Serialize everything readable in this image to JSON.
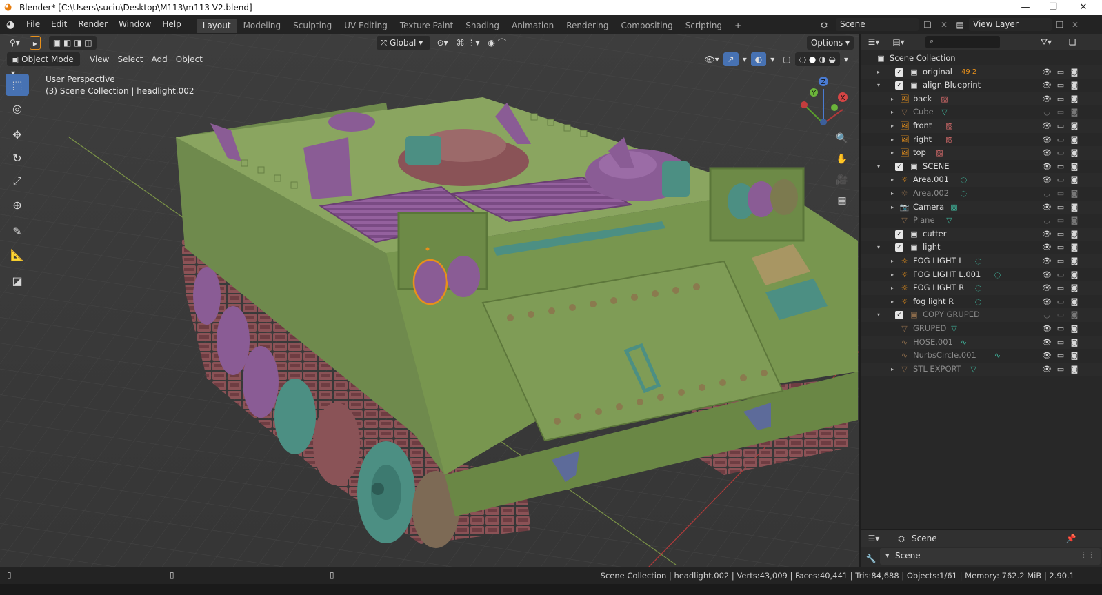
{
  "window": {
    "title": "Blender* [C:\\Users\\suciu\\Desktop\\M113\\m113 V2.blend]",
    "controls": [
      "—",
      "❐",
      "✕"
    ]
  },
  "menu": [
    "File",
    "Edit",
    "Render",
    "Window",
    "Help"
  ],
  "workspaces": [
    {
      "label": "Layout",
      "active": true
    },
    {
      "label": "Modeling"
    },
    {
      "label": "Sculpting"
    },
    {
      "label": "UV Editing"
    },
    {
      "label": "Texture Paint"
    },
    {
      "label": "Shading"
    },
    {
      "label": "Animation"
    },
    {
      "label": "Rendering"
    },
    {
      "label": "Compositing"
    },
    {
      "label": "Scripting"
    }
  ],
  "add_workspace": "+",
  "scene_field": "Scene",
  "view_layer_field": "View Layer",
  "viewport": {
    "transform_orientation": "Global",
    "options_label": "Options",
    "mode": "Object Mode",
    "header_menus": [
      "View",
      "Select",
      "Add",
      "Object"
    ],
    "overlay_line1": "User Perspective",
    "overlay_line2": "(3) Scene Collection | headlight.002",
    "gizmo_axes": {
      "x": "X",
      "y": "Y",
      "z": "Z"
    },
    "tools": [
      {
        "name": "select-box-tool",
        "icon": "⬚",
        "active": true
      },
      {
        "name": "cursor-tool",
        "icon": "◎"
      },
      {
        "name": "move-tool",
        "icon": "✥"
      },
      {
        "name": "rotate-tool",
        "icon": "↻"
      },
      {
        "name": "scale-tool",
        "icon": "⤢"
      },
      {
        "name": "transform-tool",
        "icon": "⊕"
      },
      {
        "name": "annotate-tool",
        "icon": "✎"
      },
      {
        "name": "measure-tool",
        "icon": "📐"
      },
      {
        "name": "add-cube-tool",
        "icon": "◪"
      }
    ],
    "nav_buttons": [
      {
        "name": "zoom-icon",
        "icon": "🔍"
      },
      {
        "name": "pan-hand-icon",
        "icon": "✋"
      },
      {
        "name": "camera-view-icon",
        "icon": "🎥"
      },
      {
        "name": "grid-ortho-icon",
        "icon": "▦"
      }
    ]
  },
  "outliner": {
    "root": "Scene Collection",
    "rows": [
      {
        "label": "original",
        "depth": 0,
        "expand": "▸",
        "kind": "collection",
        "check": true,
        "extra": "49 2",
        "dim": false,
        "vis_on": true
      },
      {
        "label": "align Blueprint",
        "depth": 0,
        "expand": "▾",
        "kind": "collection",
        "check": true,
        "dim": false,
        "vis_on": true
      },
      {
        "label": "back",
        "depth": 1,
        "expand": "▸",
        "kind": "image",
        "dim": false,
        "vis_on": true
      },
      {
        "label": "Cube",
        "depth": 1,
        "expand": "▸",
        "kind": "mesh",
        "dim": true,
        "vis_on": false
      },
      {
        "label": "front",
        "depth": 1,
        "expand": "▸",
        "kind": "image",
        "dim": false,
        "vis_on": true
      },
      {
        "label": "right",
        "depth": 1,
        "expand": "▸",
        "kind": "image",
        "dim": false,
        "vis_on": true
      },
      {
        "label": "top",
        "depth": 1,
        "expand": "▸",
        "kind": "image",
        "dim": false,
        "vis_on": true
      },
      {
        "label": "SCENE",
        "depth": 0,
        "expand": "▾",
        "kind": "collection",
        "check": true,
        "dim": false,
        "vis_on": true
      },
      {
        "label": "Area.001",
        "depth": 1,
        "expand": "▸",
        "kind": "light",
        "dim": false,
        "vis_on": true
      },
      {
        "label": "Area.002",
        "depth": 1,
        "expand": "▸",
        "kind": "light",
        "dim": true,
        "vis_on": false
      },
      {
        "label": "Camera",
        "depth": 1,
        "expand": "▸",
        "kind": "camera",
        "dim": false,
        "vis_on": true
      },
      {
        "label": "Plane",
        "depth": 1,
        "expand": "",
        "kind": "mesh",
        "dim": true,
        "vis_on": false
      },
      {
        "label": "cutter",
        "depth": 0,
        "expand": "",
        "kind": "collection",
        "check": true,
        "dim": false,
        "vis_on": true
      },
      {
        "label": "light",
        "depth": 0,
        "expand": "▾",
        "kind": "collection",
        "check": true,
        "dim": false,
        "vis_on": true
      },
      {
        "label": "FOG LIGHT L",
        "depth": 1,
        "expand": "▸",
        "kind": "light",
        "dim": false,
        "vis_on": true
      },
      {
        "label": "FOG LIGHT L.001",
        "depth": 1,
        "expand": "▸",
        "kind": "light",
        "dim": false,
        "vis_on": true
      },
      {
        "label": "FOG LIGHT R",
        "depth": 1,
        "expand": "▸",
        "kind": "light",
        "dim": false,
        "vis_on": true
      },
      {
        "label": "fog light R",
        "depth": 1,
        "expand": "▸",
        "kind": "light",
        "dim": false,
        "vis_on": true
      },
      {
        "label": "COPY GRUPED",
        "depth": 0,
        "expand": "▾",
        "kind": "collection",
        "check": true,
        "dim": true,
        "vis_on": false
      },
      {
        "label": "GRUPED",
        "depth": 1,
        "expand": "",
        "kind": "mesh",
        "dim": true,
        "vis_on": true
      },
      {
        "label": "HOSE.001",
        "depth": 1,
        "expand": "",
        "kind": "curve",
        "dim": true,
        "vis_on": true
      },
      {
        "label": "NurbsCircle.001",
        "depth": 1,
        "expand": "",
        "kind": "curve",
        "dim": true,
        "vis_on": true
      },
      {
        "label": "STL EXPORT",
        "depth": 1,
        "expand": "▸",
        "kind": "mesh",
        "dim": true,
        "vis_on": true
      }
    ]
  },
  "properties": {
    "context": "Scene",
    "panel": "Scene"
  },
  "statusbar": {
    "text": "Scene Collection | headlight.002 | Verts:43,009 | Faces:40,441 | Tris:84,688 | Objects:1/61 | Memory: 762.2 MiB | 2.90.1"
  },
  "colors": {
    "accent": "#4772b3",
    "hull": "#7a9656",
    "purple": "#8a5c95",
    "teal": "#4c8f83",
    "track": "#8a5357",
    "orange_select": "#e8901a"
  }
}
